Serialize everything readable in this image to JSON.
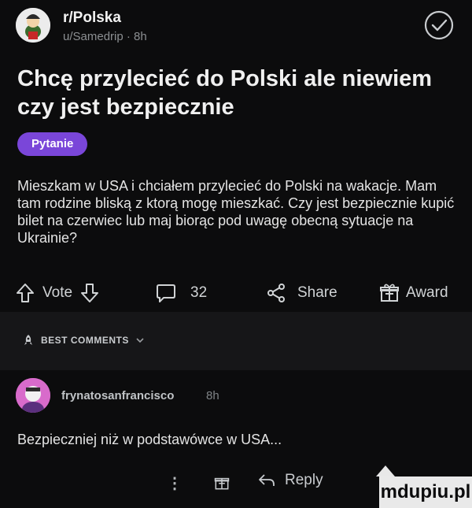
{
  "post": {
    "subreddit": "r/Polska",
    "meta": "u/Samedrip · 8h",
    "title": "Chcę przylecieć do Polski ale niewiem czy jest bezpiecznie",
    "flair": "Pytanie",
    "body": "Mieszkam w USA i chciałem przylecieć do Polski na wakacje. Mam tam rodzine bliską z ktorą mogę mieszkać. Czy jest bezpiecznie kupić bilet na czerwiec lub maj biorąc pod uwagę obecną sytuacje na Ukrainie?"
  },
  "actions": {
    "vote_label": "Vote",
    "comments_count": "32",
    "share_label": "Share",
    "award_label": "Award"
  },
  "comments_header": {
    "label": "BEST COMMENTS"
  },
  "comment": {
    "author": "frynatosanfrancisco",
    "time": "8h",
    "text": "Bezpieczniej niż w podstawówce w USA...",
    "reply_label": "Reply"
  },
  "watermark": "mdupiu.pl",
  "icons": [
    "subreddit-avatar-icon",
    "joined-check-icon",
    "upvote-icon",
    "downvote-icon",
    "comment-icon",
    "share-icon",
    "award-icon",
    "chevron-down-icon",
    "reply-icon",
    "more-icon"
  ]
}
